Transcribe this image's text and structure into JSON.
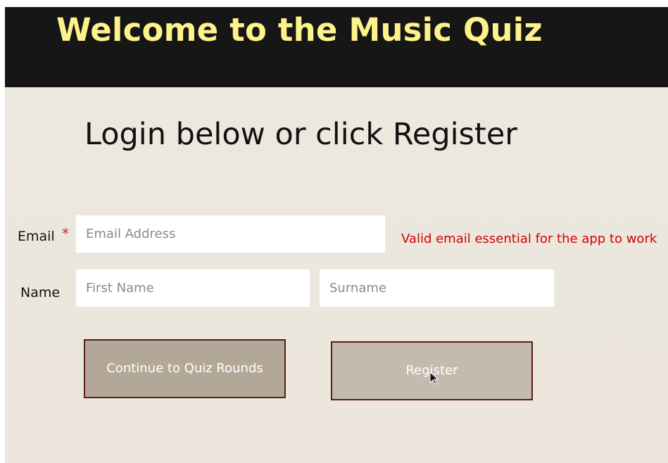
{
  "header": {
    "title": "Welcome to the Music Quiz"
  },
  "main": {
    "heading": "Login below or click Register",
    "email": {
      "label": "Email",
      "required_marker": "*",
      "placeholder": "Email Address",
      "hint": "Valid email essential for the app to work"
    },
    "name": {
      "label": "Name",
      "first_placeholder": "First Name",
      "surname_placeholder": "Surname"
    },
    "buttons": {
      "continue_label": "Continue to Quiz Rounds",
      "register_label": "Register"
    }
  },
  "colors": {
    "header_bg": "#161616",
    "title": "#fef28a",
    "page_bg": "#ede8df",
    "hint": "#d00000",
    "required": "#e02020",
    "button_border": "#5a1d1d"
  }
}
